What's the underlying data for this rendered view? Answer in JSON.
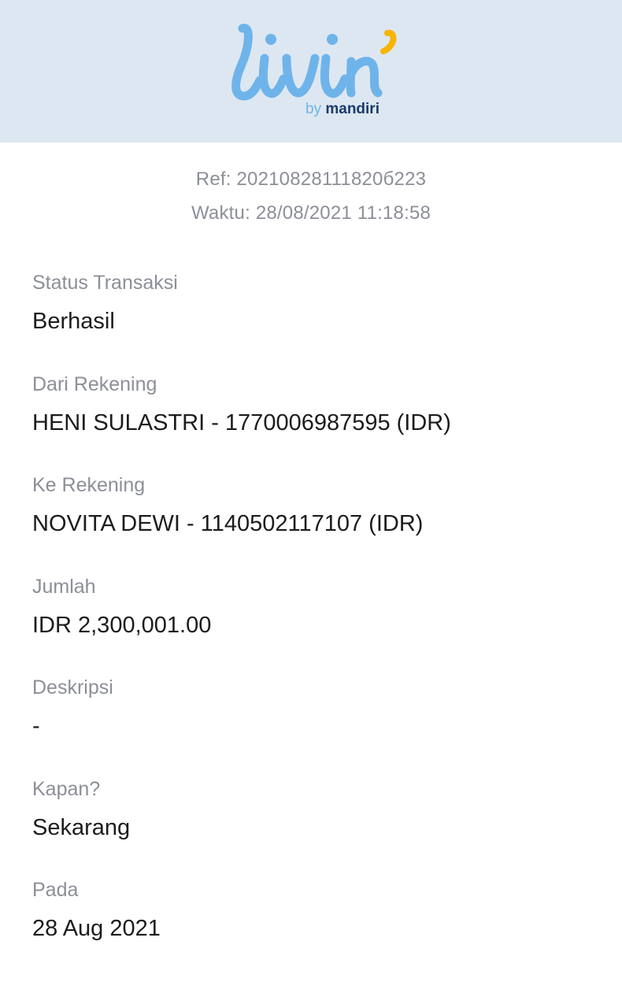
{
  "header": {
    "logo_wordmark": "livin'",
    "logo_by": "by",
    "logo_brand": "mandiri",
    "colors": {
      "background": "#dde7f1",
      "wordmark": "#6eb4ea",
      "accent": "#f7b500",
      "brand": "#1b3a6b"
    }
  },
  "meta": {
    "ref": "Ref: 20210828111820б223",
    "time": "Waktu: 28/08/2021 11:18:58"
  },
  "details": [
    {
      "label": "Status Transaksi",
      "value": "Berhasil"
    },
    {
      "label": "Dari Rekening",
      "value": "HENI SULASTRI - 1770006987595 (IDR)"
    },
    {
      "label": "Ke Rekening",
      "value": "NOVITA DEWI - 1140502117107 (IDR)"
    },
    {
      "label": "Jumlah",
      "value": "IDR 2,300,001.00"
    },
    {
      "label": "Deskripsi",
      "value": "-"
    },
    {
      "label": "Kapan?",
      "value": "Sekarang"
    },
    {
      "label": "Pada",
      "value": "28 Aug 2021"
    }
  ]
}
